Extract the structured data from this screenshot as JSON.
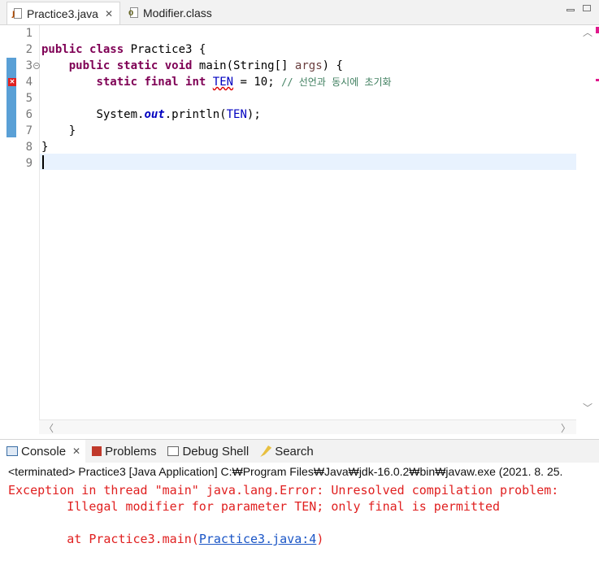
{
  "editor_tabs": [
    {
      "label": "Practice3.java",
      "active": true,
      "icon": "java-file-icon"
    },
    {
      "label": "Modifier.class",
      "active": false,
      "icon": "class-file-icon"
    }
  ],
  "code": {
    "line_numbers": [
      "1",
      "2",
      "3",
      "4",
      "5",
      "6",
      "7",
      "8",
      "9"
    ],
    "line2": {
      "kw1": "public",
      "kw2": "class",
      "rest": " Practice3 {"
    },
    "line3": {
      "kw1": "public",
      "kw2": "static",
      "kw3": "void",
      "rest1": " main(String[] ",
      "arg": "args",
      "rest2": ") {"
    },
    "line4": {
      "kw1": "static",
      "kw2": "final",
      "kw3": "int",
      "name": "TEN",
      "rest": " = 10; ",
      "comment": "// 선언과 동시에 초기화"
    },
    "line6": {
      "pre": "System.",
      "out": "out",
      "mid": ".println(",
      "arg": "TEN",
      "post": ");"
    },
    "line7": "}",
    "line8": "}"
  },
  "console": {
    "tabs": [
      {
        "label": "Console",
        "active": true,
        "icon": "console-icon"
      },
      {
        "label": "Problems",
        "active": false,
        "icon": "problems-icon"
      },
      {
        "label": "Debug Shell",
        "active": false,
        "icon": "debug-shell-icon"
      },
      {
        "label": "Search",
        "active": false,
        "icon": "search-icon"
      }
    ],
    "status": "<terminated> Practice3 [Java Application] C:₩Program Files₩Java₩jdk-16.0.2₩bin₩javaw.exe  (2021. 8. 25.",
    "output_line1": "Exception in thread \"main\" java.lang.Error: Unresolved compilation problem: ",
    "output_line2": "        Illegal modifier for parameter TEN; only final is permitted",
    "output_line3_pre": "        at Practice3.main(",
    "output_line3_link": "Practice3.java:4",
    "output_line3_post": ")"
  },
  "colors": {
    "keyword": "#7f0055",
    "comment": "#3f7f5f",
    "error_text": "#e02020",
    "link": "#1a55c6",
    "change_bar": "#5aa0d6"
  }
}
